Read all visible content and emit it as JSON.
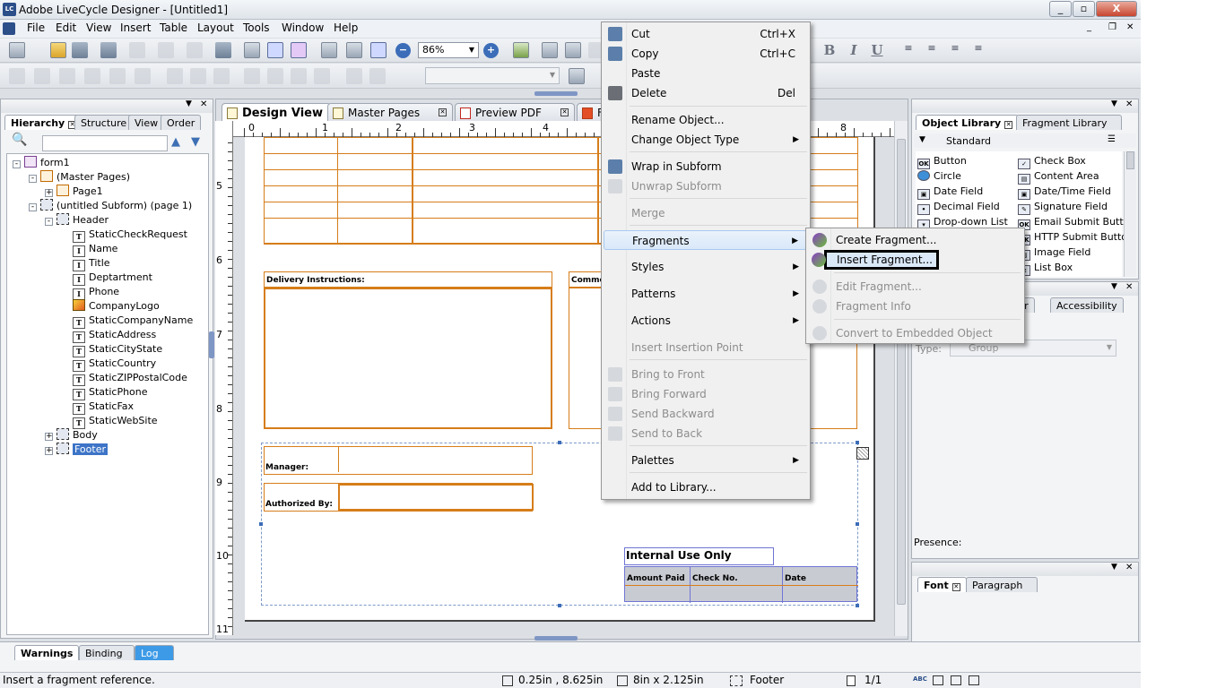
{
  "window": {
    "title": "Adobe LiveCycle Designer - [Untitled1]",
    "app_icon": "LC"
  },
  "menubar": [
    "File",
    "Edit",
    "View",
    "Insert",
    "Table",
    "Layout",
    "Tools",
    "Window",
    "Help"
  ],
  "toolbar": {
    "zoom_value": "86%"
  },
  "hierarchy_panel": {
    "tabs": [
      "Hierarchy",
      "Structure",
      "View",
      "Order"
    ],
    "tree": [
      {
        "label": "form1",
        "icon": "form-icon",
        "depth": 0,
        "expander": "-"
      },
      {
        "label": "(Master Pages)",
        "icon": "master-pages-icon",
        "depth": 1,
        "expander": "-"
      },
      {
        "label": "Page1",
        "icon": "page-icon",
        "depth": 2,
        "expander": "+"
      },
      {
        "label": "(untitled Subform) (page 1)",
        "icon": "subform-icon",
        "depth": 1,
        "expander": "-"
      },
      {
        "label": "Header",
        "icon": "subform-icon",
        "depth": 2,
        "expander": "-"
      },
      {
        "label": "StaticCheckRequest",
        "icon": "text-icon",
        "depth": 3
      },
      {
        "label": "Name",
        "icon": "textfield-icon",
        "depth": 3
      },
      {
        "label": "Title",
        "icon": "textfield-icon",
        "depth": 3
      },
      {
        "label": "Deptartment",
        "icon": "textfield-icon",
        "depth": 3
      },
      {
        "label": "Phone",
        "icon": "textfield-icon",
        "depth": 3
      },
      {
        "label": "CompanyLogo",
        "icon": "image-icon",
        "depth": 3
      },
      {
        "label": "StaticCompanyName",
        "icon": "text-icon",
        "depth": 3
      },
      {
        "label": "StaticAddress",
        "icon": "text-icon",
        "depth": 3
      },
      {
        "label": "StaticCityState",
        "icon": "text-icon",
        "depth": 3
      },
      {
        "label": "StaticCountry",
        "icon": "text-icon",
        "depth": 3
      },
      {
        "label": "StaticZIPPostalCode",
        "icon": "text-icon",
        "depth": 3
      },
      {
        "label": "StaticPhone",
        "icon": "text-icon",
        "depth": 3
      },
      {
        "label": "StaticFax",
        "icon": "text-icon",
        "depth": 3
      },
      {
        "label": "StaticWebSite",
        "icon": "text-icon",
        "depth": 3
      },
      {
        "label": "Body",
        "icon": "subform-icon",
        "depth": 2,
        "expander": "+"
      },
      {
        "label": "Footer",
        "icon": "subform-icon",
        "depth": 2,
        "expander": "+",
        "selected": true
      }
    ]
  },
  "editor": {
    "tabs": [
      "Design View",
      "Master Pages",
      "Preview PDF",
      "F"
    ],
    "ruler_top": [
      "0",
      "1",
      "2",
      "3",
      "4",
      "8"
    ],
    "ruler_left": [
      "5",
      "6",
      "7",
      "8",
      "9",
      "10",
      "11"
    ],
    "form": {
      "delivery_label": "Delivery Instructions:",
      "comments_label": "Comme",
      "manager_label": "Manager:",
      "authorized_label": "Authorized By:",
      "internal_title": "Internal Use Only",
      "internal_cols": [
        "Amount Paid",
        "Check No.",
        "Date"
      ]
    }
  },
  "context_menu": {
    "items": [
      {
        "label": "Cut",
        "shortcut": "Ctrl+X",
        "icon": "scissors-icon"
      },
      {
        "label": "Copy",
        "shortcut": "Ctrl+C",
        "icon": "copy-icon"
      },
      {
        "label": "Paste",
        "shortcut": ""
      },
      {
        "label": "Delete",
        "shortcut": "Del",
        "icon": "trash-icon"
      },
      {
        "label": "Rename Object..."
      },
      {
        "label": "Change Object Type",
        "submenu": true
      },
      {
        "label": "Wrap in Subform",
        "icon": "wrap-subform-icon"
      },
      {
        "label": "Unwrap Subform",
        "disabled": true,
        "icon": "unwrap-subform-icon"
      },
      {
        "label": "Merge",
        "disabled": true
      },
      {
        "label": "Fragments",
        "submenu": true,
        "hover": true
      },
      {
        "label": "Styles",
        "submenu": true
      },
      {
        "label": "Patterns",
        "submenu": true
      },
      {
        "label": "Actions",
        "submenu": true
      },
      {
        "label": "Insert Insertion Point",
        "disabled": true
      },
      {
        "label": "Bring to Front",
        "disabled": true,
        "icon": "bring-front-icon"
      },
      {
        "label": "Bring Forward",
        "disabled": true,
        "icon": "bring-forward-icon"
      },
      {
        "label": "Send Backward",
        "disabled": true,
        "icon": "send-backward-icon"
      },
      {
        "label": "Send to Back",
        "disabled": true,
        "icon": "send-back-icon"
      },
      {
        "label": "Palettes",
        "submenu": true
      },
      {
        "label": "Add to Library..."
      }
    ]
  },
  "fragments_submenu": {
    "items": [
      {
        "label": "Create Fragment...",
        "icon": "create-fragment-icon"
      },
      {
        "label": "Insert Fragment...",
        "icon": "insert-fragment-icon",
        "focused": true
      },
      {
        "label": "Edit Fragment...",
        "disabled": true,
        "icon": "edit-fragment-icon"
      },
      {
        "label": "Fragment Info",
        "disabled": true,
        "icon": "fragment-info-icon"
      },
      {
        "label": "Convert to Embedded Object",
        "disabled": true,
        "icon": "convert-fragment-icon"
      }
    ]
  },
  "object_library": {
    "tabs": [
      "Object Library",
      "Fragment Library"
    ],
    "category": "Standard",
    "items_left": [
      "Button",
      "Circle",
      "Date Field",
      "Decimal Field",
      "Drop-down List"
    ],
    "items_right": [
      "Check Box",
      "Content Area",
      "Date/Time Field",
      "Signature Field",
      "Email Submit Butto",
      "HTTP Submit Butto",
      "Image Field",
      "List Box"
    ]
  },
  "object_panel": {
    "tabs_partial": [
      "rder",
      "Accessibility"
    ],
    "type_label": "Type:",
    "type_value": "Group",
    "presence_label": "Presence:"
  },
  "font_panel": {
    "tabs": [
      "Font",
      "Paragraph"
    ]
  },
  "bottom_panel": {
    "tabs": [
      "Warnings",
      "Binding",
      "Log"
    ]
  },
  "statusbar": {
    "message": "Insert a fragment reference.",
    "position": "0.25in , 8.625in",
    "size": "8in x 2.125in",
    "object": "Footer",
    "page": "1/1"
  }
}
